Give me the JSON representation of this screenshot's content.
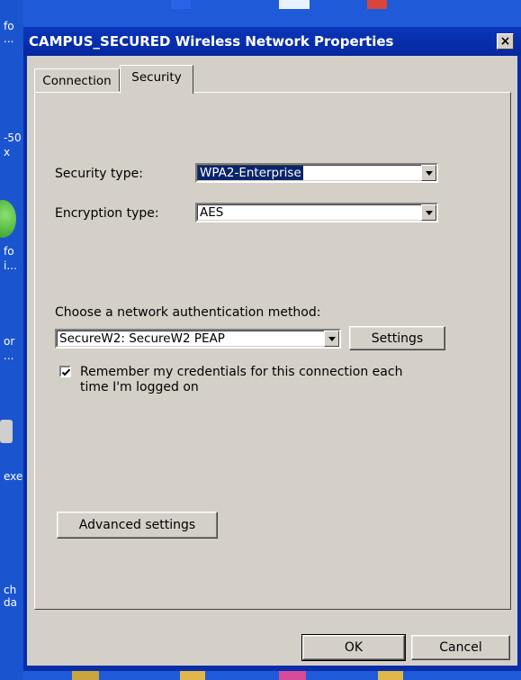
{
  "desktop": {
    "fragments": [
      "fo",
      "...",
      "-50",
      "x",
      "fo",
      "i...",
      "or",
      "...",
      "exe",
      "ch",
      "da"
    ]
  },
  "dialog": {
    "title": "CAMPUS_SECURED Wireless Network Properties",
    "close_label": "×",
    "tabs": [
      {
        "label": "Connection",
        "active": false
      },
      {
        "label": "Security",
        "active": true
      }
    ],
    "security_type": {
      "label": "Security type:",
      "value": "WPA2-Enterprise"
    },
    "encryption_type": {
      "label": "Encryption type:",
      "value": "AES"
    },
    "auth_method": {
      "label": "Choose a network authentication method:",
      "value": "SecureW2: SecureW2 PEAP",
      "settings_label": "Settings"
    },
    "remember_credentials": {
      "checked": true,
      "line1": "Remember my credentials for this connection each",
      "line2": "time I'm logged on"
    },
    "advanced_settings_label": "Advanced settings",
    "ok_label": "OK",
    "cancel_label": "Cancel"
  }
}
